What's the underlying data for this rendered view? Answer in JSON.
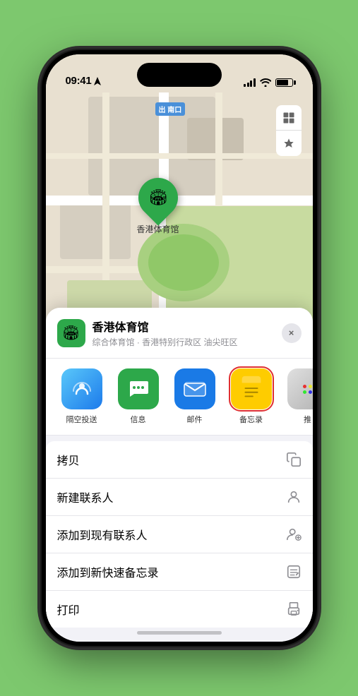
{
  "status_bar": {
    "time": "09:41",
    "time_icon": "location-arrow-icon"
  },
  "map": {
    "label_badge": "南口",
    "label_prefix": "出",
    "controls": {
      "map_icon": "🗺",
      "location_icon": "⬆"
    }
  },
  "marker": {
    "label": "香港体育馆",
    "icon": "🏟"
  },
  "location_card": {
    "title": "香港体育馆",
    "subtitle": "综合体育馆 · 香港特别行政区 油尖旺区",
    "icon": "🏟"
  },
  "share_items": [
    {
      "id": "airdrop",
      "label": "隔空投送",
      "type": "airdrop"
    },
    {
      "id": "messages",
      "label": "信息",
      "type": "messages"
    },
    {
      "id": "mail",
      "label": "邮件",
      "type": "mail"
    },
    {
      "id": "notes",
      "label": "备忘录",
      "type": "notes"
    },
    {
      "id": "more",
      "label": "推",
      "type": "more"
    }
  ],
  "action_items": [
    {
      "label": "拷贝",
      "icon": "copy"
    },
    {
      "label": "新建联系人",
      "icon": "person"
    },
    {
      "label": "添加到现有联系人",
      "icon": "person-add"
    },
    {
      "label": "添加到新快速备忘录",
      "icon": "note"
    },
    {
      "label": "打印",
      "icon": "printer"
    }
  ],
  "close_label": "×"
}
